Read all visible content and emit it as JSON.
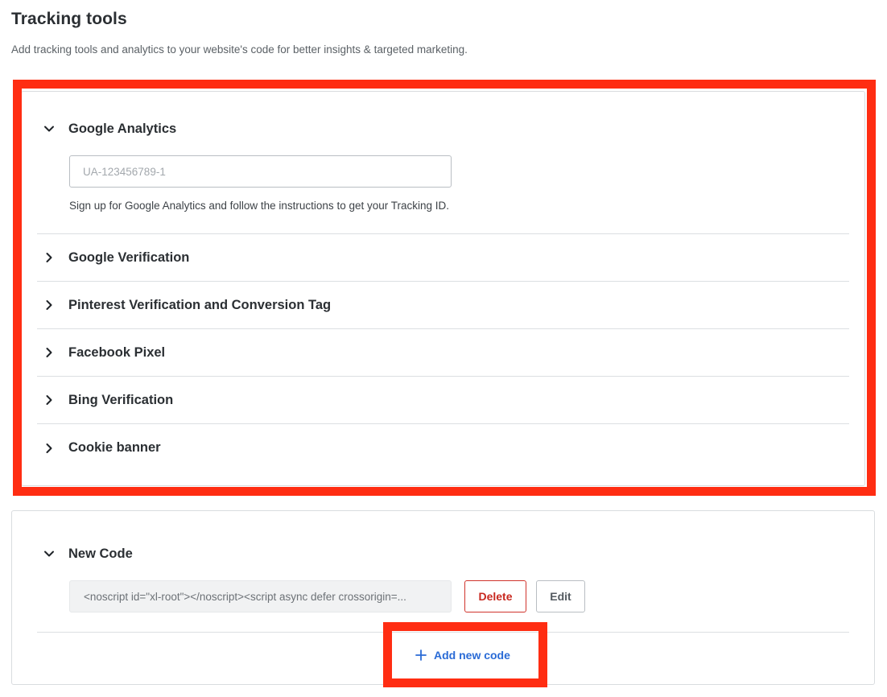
{
  "header": {
    "title": "Tracking tools",
    "description": "Add tracking tools and analytics to your website's code for better insights & targeted marketing."
  },
  "tracking_tools": {
    "google_analytics": {
      "label": "Google Analytics",
      "expanded": true,
      "input_value": "",
      "input_placeholder": "UA-123456789-1",
      "help_text": "Sign up for Google Analytics and follow the instructions to get your Tracking ID."
    },
    "items": [
      {
        "label": "Google Verification",
        "expanded": false
      },
      {
        "label": "Pinterest Verification and Conversion Tag",
        "expanded": false
      },
      {
        "label": "Facebook Pixel",
        "expanded": false
      },
      {
        "label": "Bing Verification",
        "expanded": false
      },
      {
        "label": "Cookie banner",
        "expanded": false
      }
    ]
  },
  "custom_code": {
    "section_label": "New Code",
    "expanded": true,
    "code_preview": "<noscript id=\"xl-root\"></noscript><script async defer crossorigin=...",
    "delete_label": "Delete",
    "edit_label": "Edit",
    "add_label": "Add new code"
  },
  "icons": {
    "expanded": "chevron-down-icon",
    "collapsed": "chevron-right-icon",
    "add": "plus-icon"
  },
  "colors": {
    "highlight": "#ff2d12",
    "link": "#2a6bd6",
    "danger": "#c8281f",
    "title_text": "#2b2f33",
    "muted_text": "#5b6166"
  }
}
